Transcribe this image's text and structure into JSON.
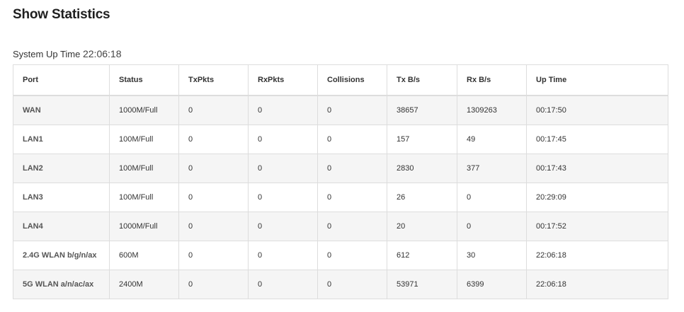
{
  "page": {
    "title": "Show Statistics",
    "uptime_label": "System Up Time",
    "uptime_value": "22:06:18"
  },
  "table": {
    "headers": [
      "Port",
      "Status",
      "TxPkts",
      "RxPkts",
      "Collisions",
      "Tx B/s",
      "Rx B/s",
      "Up Time"
    ],
    "rows": [
      [
        "WAN",
        "1000M/Full",
        "0",
        "0",
        "0",
        "38657",
        "1309263",
        "00:17:50"
      ],
      [
        "LAN1",
        "100M/Full",
        "0",
        "0",
        "0",
        "157",
        "49",
        "00:17:45"
      ],
      [
        "LAN2",
        "100M/Full",
        "0",
        "0",
        "0",
        "2830",
        "377",
        "00:17:43"
      ],
      [
        "LAN3",
        "100M/Full",
        "0",
        "0",
        "0",
        "26",
        "0",
        "20:29:09"
      ],
      [
        "LAN4",
        "1000M/Full",
        "0",
        "0",
        "0",
        "20",
        "0",
        "00:17:52"
      ],
      [
        "2.4G WLAN b/g/n/ax",
        "600M",
        "0",
        "0",
        "0",
        "612",
        "30",
        "22:06:18"
      ],
      [
        "5G WLAN a/n/ac/ax",
        "2400M",
        "0",
        "0",
        "0",
        "53971",
        "6399",
        "22:06:18"
      ]
    ]
  }
}
